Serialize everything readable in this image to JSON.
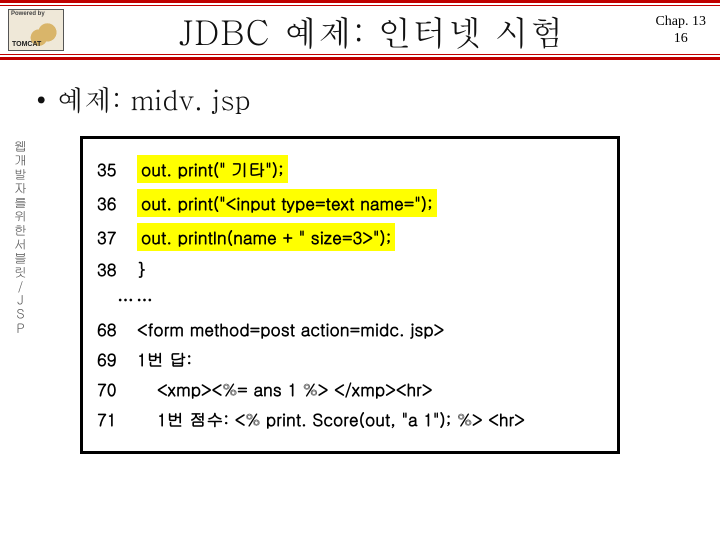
{
  "header": {
    "logo_powered": "Powered by",
    "logo_name": "TOMCAT",
    "title": "JDBC 예제: 인터넷 시험"
  },
  "chapter": {
    "line1": "Chap. 13",
    "line2": "16"
  },
  "sidebar_text": "웹개발자를위한서블릿/JSP",
  "bullet_text": "예제: midv. jsp",
  "code": {
    "rows": [
      {
        "ln": "35",
        "text": "out. print(\" 기타\");",
        "hl": true
      },
      {
        "ln": "36",
        "text": "out. print(\"<input type=text name=\");",
        "hl": true
      },
      {
        "ln": "37",
        "text": "out. println(name + \" size=3>\");",
        "hl": true
      },
      {
        "ln": "38",
        "text": "}",
        "hl": false
      }
    ],
    "dots": "……",
    "rows2": [
      {
        "ln": "68",
        "text": "<form method=post action=midc. jsp>"
      },
      {
        "ln": "69",
        "text": "1번 답:"
      },
      {
        "ln": "70",
        "text": "<xmp><%= ans 1 %> </xmp><hr>"
      },
      {
        "ln": "71",
        "text": "1번 점수: <% print. Score(out, \"a 1\"); %> <hr>"
      }
    ]
  }
}
